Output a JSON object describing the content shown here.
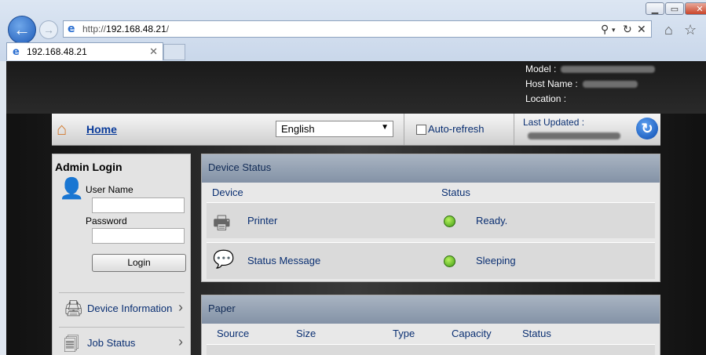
{
  "browser": {
    "url_prefix": "http://",
    "url_host": "192.168.48.21",
    "url_suffix": "/",
    "tab_title": "192.168.48.21"
  },
  "device_info": {
    "model_label": "Model :",
    "host_label": "Host Name :",
    "location_label": "Location :"
  },
  "toolbar": {
    "home": "Home",
    "language": "English",
    "auto_refresh": "Auto-refresh",
    "last_updated": "Last Updated :"
  },
  "admin": {
    "title": "Admin Login",
    "user_label": "User Name",
    "password_label": "Password",
    "login": "Login"
  },
  "nav": {
    "device_info": "Device Information",
    "job_status": "Job Status"
  },
  "device_status": {
    "title": "Device Status",
    "col_device": "Device",
    "col_status": "Status",
    "rows": [
      {
        "device": "Printer",
        "status": "Ready."
      },
      {
        "device": "Status Message",
        "status": "Sleeping"
      }
    ]
  },
  "paper": {
    "title": "Paper",
    "columns": [
      "Source",
      "Size",
      "Type",
      "Capacity",
      "Status"
    ]
  },
  "colors": {
    "link": "#0a3b9a",
    "status_ok": "#5fc01e"
  }
}
